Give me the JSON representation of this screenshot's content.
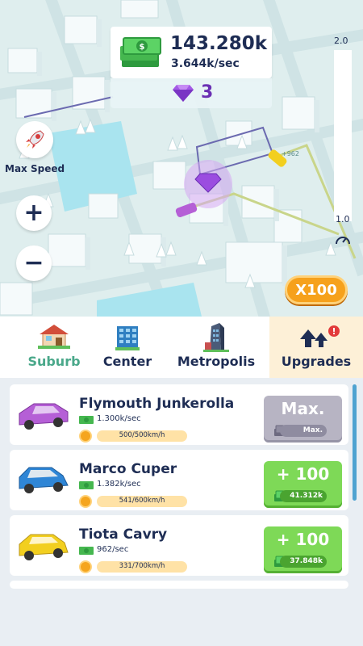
{
  "hud": {
    "money_total": "143.280k",
    "money_rate": "3.644k/sec",
    "gems": "3",
    "floating_income": "+962"
  },
  "controls": {
    "max_speed_label": "Max Speed",
    "speed_scale_max": "2.0",
    "speed_scale_min": "1.0",
    "multiplier_label": "X100"
  },
  "tabs": [
    {
      "label": "Suburb",
      "icon": "house-icon",
      "selected": true
    },
    {
      "label": "Center",
      "icon": "office-building-icon",
      "selected": false
    },
    {
      "label": "Metropolis",
      "icon": "skyscraper-icon",
      "selected": false
    },
    {
      "label": "Upgrades",
      "icon": "upgrade-arrows-icon",
      "selected": false,
      "badge": "!"
    }
  ],
  "cars": [
    {
      "name": "Flymouth Junkerolla",
      "rate": "1.300k/sec",
      "speed": "500/500km/h",
      "button_main": "Max.",
      "button_sub": "Max.",
      "color": "#b55fd6",
      "maxed": true
    },
    {
      "name": "Marco Cuper",
      "rate": "1.382k/sec",
      "speed": "541/600km/h",
      "button_main": "+ 100",
      "button_sub": "41.312k",
      "color": "#2f86d6",
      "maxed": false
    },
    {
      "name": "Tiota Cavry",
      "rate": "962/sec",
      "speed": "331/700km/h",
      "button_main": "+ 100",
      "button_sub": "37.848k",
      "color": "#f2cf1f",
      "maxed": false
    }
  ],
  "colors": {
    "navy_text": "#1e2d54",
    "green_button": "#7ed957",
    "orange_button": "#f6a11c",
    "gem_purple": "#6a2fb3",
    "selected_tab_bg": "#fdf0d7"
  }
}
